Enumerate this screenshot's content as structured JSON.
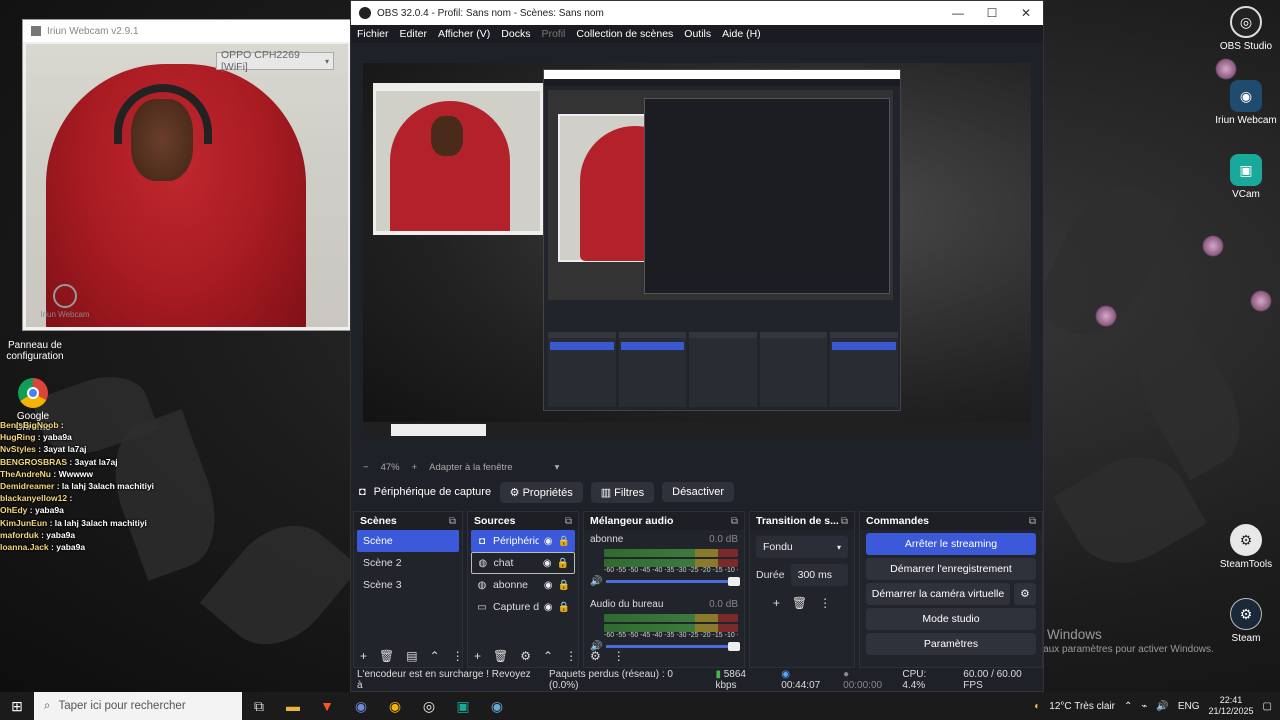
{
  "desktop": {
    "icons_left": [
      {
        "label": "Panneau de configuration",
        "icon": "control-panel-icon"
      },
      {
        "label": "Google Chrome",
        "icon": "chrome-icon"
      }
    ],
    "icons_right": [
      {
        "label": "OBS Studio",
        "icon": "obs-icon"
      },
      {
        "label": "Iriun Webcam",
        "icon": "iriun-icon"
      },
      {
        "label": "VCam",
        "icon": "vcam-icon"
      },
      {
        "label": "SteamTools",
        "icon": "steamtools-icon"
      },
      {
        "label": "Steam",
        "icon": "steam-icon"
      }
    ],
    "activation": {
      "title": "Activer Windows",
      "subtitle": "Accédez aux paramètres pour activer Windows."
    }
  },
  "iriun": {
    "title": "Iriun Webcam v2.9.1",
    "device": "OPPO CPH2269 [WiFi]",
    "watermark": "Iriun Webcam"
  },
  "chat": [
    {
      "user": "BenlsBigNoob",
      "msg": ""
    },
    {
      "user": "HugRing",
      "msg": "yaba9a"
    },
    {
      "user": "NvStyles",
      "msg": "3ayat la7aj"
    },
    {
      "user": "BENGROSBRAS",
      "msg": "3ayat la7aj"
    },
    {
      "user": "TheAndreNu",
      "msg": "Wwwww"
    },
    {
      "user": "Demidreamer",
      "msg": "la lahj 3alach machitiyi"
    },
    {
      "user": "blackanyellow12",
      "msg": ""
    },
    {
      "user": "OhEdy",
      "msg": "yaba9a"
    },
    {
      "user": "KimJunEun",
      "msg": "la lahj 3alach machitiyi"
    },
    {
      "user": "maforduk",
      "msg": "yaba9a"
    },
    {
      "user": "loanna.Jack",
      "msg": "yaba9a"
    }
  ],
  "obs": {
    "title": "OBS 32.0.4 - Profil: Sans nom - Scènes: Sans nom",
    "menu": [
      "Fichier",
      "Editer",
      "Afficher (V)",
      "Docks",
      "Profil",
      "Collection de scènes",
      "Outils",
      "Aide (H)"
    ],
    "zoom": "47%",
    "fit_label": "Adapter à la fenêtre",
    "source_bar": {
      "source_name": "Périphérique de capture vidéo",
      "properties": "Propriétés",
      "filters": "Filtres",
      "deactivate": "Désactiver"
    },
    "docks": {
      "scenes": {
        "title": "Scènes",
        "items": [
          "Scène",
          "Scène 2",
          "Scène 3"
        ]
      },
      "sources": {
        "title": "Sources",
        "items": [
          {
            "name": "Périphérique",
            "icon": "camera-icon"
          },
          {
            "name": "chat",
            "icon": "globe-icon"
          },
          {
            "name": "abonne",
            "icon": "globe-icon"
          },
          {
            "name": "Capture d'",
            "icon": "monitor-icon"
          }
        ]
      },
      "mixer": {
        "title": "Mélangeur audio",
        "ticks": "-60 -55 -50 -45 -40 -35 -30 -25 -20 -15 -10 -5 0",
        "channels": [
          {
            "name": "abonne",
            "db": "0.0 dB",
            "level": 1.0
          },
          {
            "name": "Audio du bureau",
            "db": "0.0 dB",
            "level": 1.0
          }
        ]
      },
      "transitions": {
        "title": "Transition de s...",
        "type": "Fondu",
        "duration_label": "Durée",
        "duration": "300 ms"
      },
      "commands": {
        "title": "Commandes",
        "buttons": [
          "Arrêter le streaming",
          "Démarrer l'enregistrement",
          "Démarrer la caméra virtuelle",
          "Mode studio",
          "Paramètres"
        ]
      }
    },
    "status": {
      "encoder": "L'encodeur est en surcharge ! Revoyez à",
      "dropped": "Paquets perdus (réseau) : 0 (0.0%)",
      "bitrate": "5864 kbps",
      "stream_time": "00:44:07",
      "rec_time": "00:00:00",
      "cpu": "CPU: 4.4%",
      "fps": "60.00 / 60.00 FPS"
    }
  },
  "taskbar": {
    "search_placeholder": "Taper ici pour rechercher",
    "weather": "12°C  Très clair",
    "lang": "ENG",
    "time": "22:41",
    "date": "21/12/2025"
  }
}
